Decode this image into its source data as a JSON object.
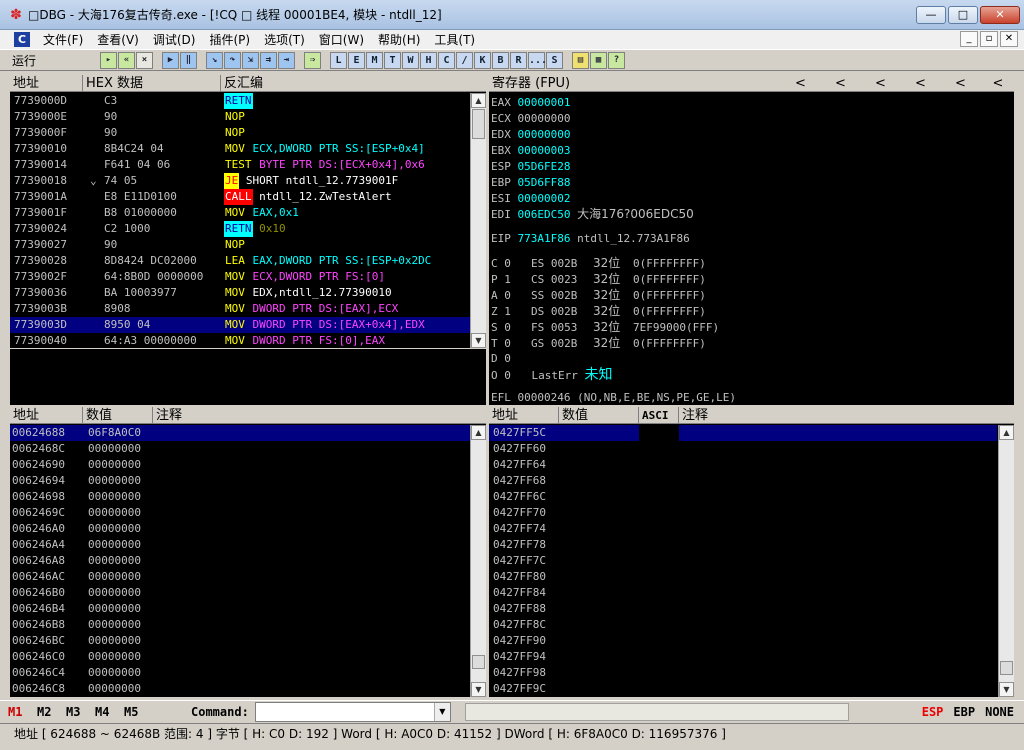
{
  "window": {
    "title": "□DBG - 大海176复古传奇.exe - [!CQ □ 线程 00001BE4, 模块 - ntdll_12]",
    "min": "—",
    "max": "□",
    "close": "✕"
  },
  "menu": [
    "文件(F)",
    "查看(V)",
    "调试(D)",
    "插件(P)",
    "选项(T)",
    "窗口(W)",
    "帮助(H)",
    "工具(T)"
  ],
  "mdi": [
    "_",
    "▫",
    "✕"
  ],
  "toolbar": {
    "status": "运行",
    "letters": [
      "L",
      "E",
      "M",
      "T",
      "W",
      "H",
      "C",
      "/",
      "K",
      "B",
      "R",
      "...",
      "S"
    ]
  },
  "disasm": {
    "headers": [
      "地址",
      "HEX 数据",
      "反汇编"
    ],
    "rows": [
      {
        "addr": "7739000D",
        "jmp": "",
        "hex": "C3",
        "mn": "RETN",
        "mc": "retn",
        "op": "",
        "oc": "gray"
      },
      {
        "addr": "7739000E",
        "jmp": "",
        "hex": "90",
        "mn": "NOP",
        "mc": "plain",
        "op": "",
        "oc": "gray"
      },
      {
        "addr": "7739000F",
        "jmp": "",
        "hex": "90",
        "mn": "NOP",
        "mc": "plain",
        "op": "",
        "oc": "gray"
      },
      {
        "addr": "77390010",
        "jmp": "",
        "hex": "8B4C24 04",
        "mn": "MOV",
        "mc": "plain",
        "op": "ECX,DWORD PTR SS:[ESP+0x4]",
        "oc": "cyan"
      },
      {
        "addr": "77390014",
        "jmp": "",
        "hex": "F641 04 06",
        "mn": "TEST",
        "mc": "plain",
        "op": "BYTE PTR DS:[ECX+0x4],0x6",
        "oc": "mag"
      },
      {
        "addr": "77390018",
        "jmp": "⌄",
        "hex": "74 05",
        "mn": "JE",
        "mc": "je",
        "op": "SHORT ntdll_12.7739001F",
        "oc": "wht"
      },
      {
        "addr": "7739001A",
        "jmp": "",
        "hex": "E8 E11D0100",
        "mn": "CALL",
        "mc": "call",
        "op": "ntdll_12.ZwTestAlert",
        "oc": "wht"
      },
      {
        "addr": "7739001F",
        "jmp": "",
        "hex": "B8 01000000",
        "mn": "MOV",
        "mc": "plain",
        "op": "EAX,0x1",
        "oc": "cyan"
      },
      {
        "addr": "77390024",
        "jmp": "",
        "hex": "C2 1000",
        "mn": "RETN",
        "mc": "retn",
        "op": "0x10",
        "oc": "dk"
      },
      {
        "addr": "77390027",
        "jmp": "",
        "hex": "90",
        "mn": "NOP",
        "mc": "plain",
        "op": "",
        "oc": "gray"
      },
      {
        "addr": "77390028",
        "jmp": "",
        "hex": "8D8424 DC02000",
        "mn": "LEA",
        "mc": "plain",
        "op": "EAX,DWORD PTR SS:[ESP+0x2DC",
        "oc": "cyan"
      },
      {
        "addr": "7739002F",
        "jmp": "",
        "hex": "64:8B0D 0000000",
        "mn": "MOV",
        "mc": "plain",
        "op": "ECX,DWORD PTR FS:[0]",
        "oc": "mag"
      },
      {
        "addr": "77390036",
        "jmp": "",
        "hex": "BA 10003977",
        "mn": "MOV",
        "mc": "plain",
        "op": "EDX,ntdll_12.77390010",
        "oc": "wht"
      },
      {
        "addr": "7739003B",
        "jmp": "",
        "hex": "8908",
        "mn": "MOV",
        "mc": "plain",
        "op": "DWORD PTR DS:[EAX],ECX",
        "oc": "mag"
      },
      {
        "addr": "7739003D",
        "jmp": "",
        "hex": "8950 04",
        "mn": "MOV",
        "mc": "plain",
        "op": "DWORD PTR DS:[EAX+0x4],EDX",
        "oc": "mag",
        "sel": true
      },
      {
        "addr": "77390040",
        "jmp": "",
        "hex": "64:A3 00000000",
        "mn": "MOV",
        "mc": "plain",
        "op": "DWORD PTR FS:[0],EAX",
        "oc": "mag"
      }
    ]
  },
  "registers": {
    "header": "寄存器 (FPU)",
    "arrows": [
      "<",
      "<",
      "<",
      "<",
      "<",
      "<"
    ],
    "gp": [
      {
        "name": "EAX",
        "val": "00000001",
        "hl": true,
        "note": ""
      },
      {
        "name": "ECX",
        "val": "00000000",
        "hl": false,
        "note": ""
      },
      {
        "name": "EDX",
        "val": "00000000",
        "hl": true,
        "note": ""
      },
      {
        "name": "EBX",
        "val": "00000003",
        "hl": true,
        "note": ""
      },
      {
        "name": "ESP",
        "val": "05D6FE28",
        "hl": true,
        "note": ""
      },
      {
        "name": "EBP",
        "val": "05D6FF88",
        "hl": true,
        "note": ""
      },
      {
        "name": "ESI",
        "val": "00000002",
        "hl": true,
        "note": ""
      },
      {
        "name": "EDI",
        "val": "006EDC50",
        "hl": true,
        "note": "大海176?006EDC50"
      }
    ],
    "eip": {
      "name": "EIP",
      "val": "773A1F86",
      "note": "ntdll_12.773A1F86"
    },
    "seg": [
      {
        "flag": "C 0",
        "seg": "ES 002B",
        "bits": "32位",
        "info": "0(FFFFFFFF)"
      },
      {
        "flag": "P 1",
        "seg": "CS 0023",
        "bits": "32位",
        "info": "0(FFFFFFFF)"
      },
      {
        "flag": "A 0",
        "seg": "SS 002B",
        "bits": "32位",
        "info": "0(FFFFFFFF)"
      },
      {
        "flag": "Z 1",
        "seg": "DS 002B",
        "bits": "32位",
        "info": "0(FFFFFFFF)"
      },
      {
        "flag": "S 0",
        "seg": "FS 0053",
        "bits": "32位",
        "info": "7EF99000(FFF)"
      },
      {
        "flag": "T 0",
        "seg": "GS 002B",
        "bits": "32位",
        "info": "0(FFFFFFFF)"
      }
    ],
    "d": "D 0",
    "o": "O 0",
    "lasterr": "LastErr",
    "lasterr_val": "未知",
    "efl": "EFL 00000246 (NO,NB,E,BE,NS,PE,GE,LE)"
  },
  "dump": {
    "headers": [
      "地址",
      "数值",
      "注释"
    ],
    "rows": [
      {
        "addr": "00624688",
        "val": "06F8A0C0",
        "sel": true
      },
      {
        "addr": "0062468C",
        "val": "00000000"
      },
      {
        "addr": "00624690",
        "val": "00000000"
      },
      {
        "addr": "00624694",
        "val": "00000000"
      },
      {
        "addr": "00624698",
        "val": "00000000"
      },
      {
        "addr": "0062469C",
        "val": "00000000"
      },
      {
        "addr": "006246A0",
        "val": "00000000"
      },
      {
        "addr": "006246A4",
        "val": "00000000"
      },
      {
        "addr": "006246A8",
        "val": "00000000"
      },
      {
        "addr": "006246AC",
        "val": "00000000"
      },
      {
        "addr": "006246B0",
        "val": "00000000"
      },
      {
        "addr": "006246B4",
        "val": "00000000"
      },
      {
        "addr": "006246B8",
        "val": "00000000"
      },
      {
        "addr": "006246BC",
        "val": "00000000"
      },
      {
        "addr": "006246C0",
        "val": "00000000"
      },
      {
        "addr": "006246C4",
        "val": "00000000"
      },
      {
        "addr": "006246C8",
        "val": "00000000"
      }
    ]
  },
  "stack": {
    "headers": [
      "地址",
      "数值",
      "ASCI",
      "注释"
    ],
    "rows": [
      "0427FF5C",
      "0427FF60",
      "0427FF64",
      "0427FF68",
      "0427FF6C",
      "0427FF70",
      "0427FF74",
      "0427FF78",
      "0427FF7C",
      "0427FF80",
      "0427FF84",
      "0427FF88",
      "0427FF8C",
      "0427FF90",
      "0427FF94",
      "0427FF98",
      "0427FF9C"
    ]
  },
  "cmd": {
    "marks": [
      "M1",
      "M2",
      "M3",
      "M4",
      "M5"
    ],
    "label": "Command:",
    "value": "",
    "regs": [
      "ESP",
      "EBP",
      "NONE"
    ]
  },
  "status": "地址 [ 624688 ~ 62468B 范围: 4 ] 字节 [ H: C0 D: 192 ] Word [ H: A0C0 D: 41152 ] DWord [ H: 6F8A0C0 D: 116957376 ]",
  "colors": {
    "selection": "#000080",
    "reg_changed": "#00ffff",
    "jump": "#ffff00",
    "call_bg": "#ff0000"
  }
}
